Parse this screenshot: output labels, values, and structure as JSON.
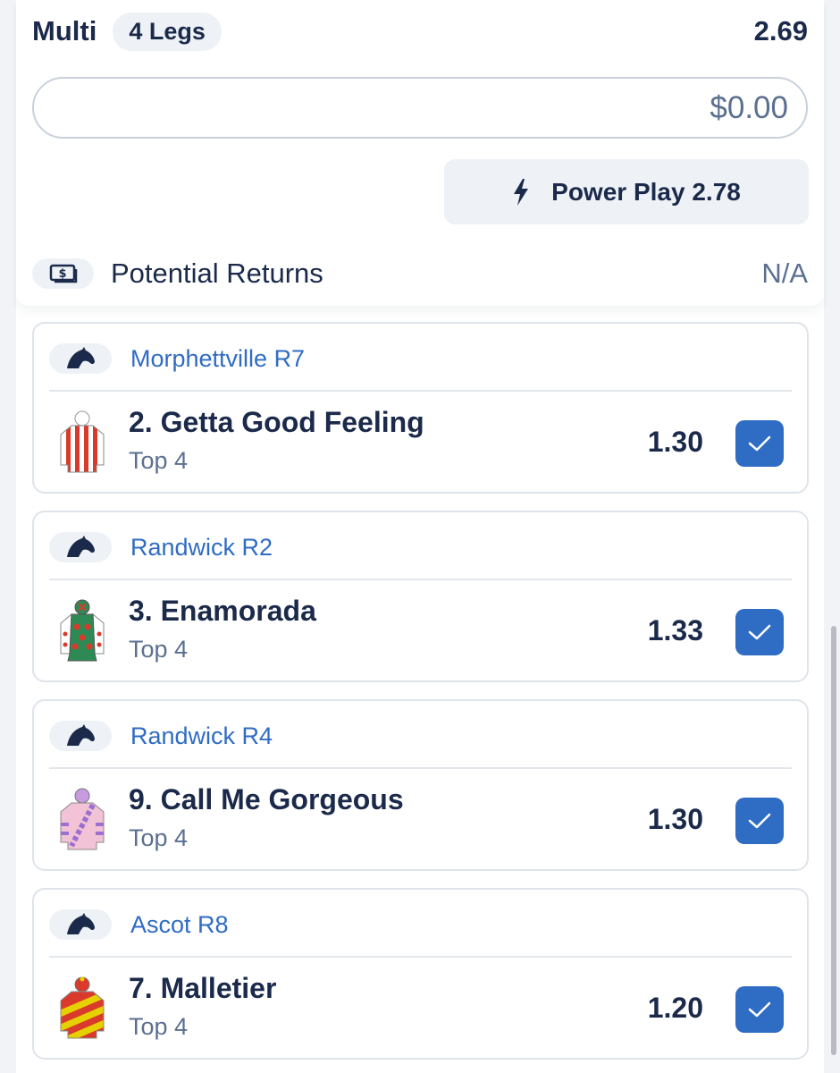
{
  "bet_slip": {
    "title": "Multi",
    "legs_count": "4 Legs",
    "total_odds": "2.69",
    "stake_value": "$0.00",
    "power_play_label": "Power Play 2.78",
    "potential_returns_label": "Potential Returns",
    "potential_returns_value": "N/A"
  },
  "legs": [
    {
      "race": "Morphettville R7",
      "runner": "2. Getta Good Feeling",
      "market": "Top 4",
      "odds": "1.30",
      "selected": true,
      "silk_icon": "jockey-silk-red-white-stripes-icon"
    },
    {
      "race": "Randwick R2",
      "runner": "3. Enamorada",
      "market": "Top 4",
      "odds": "1.33",
      "selected": true,
      "silk_icon": "jockey-silk-green-red-stars-icon"
    },
    {
      "race": "Randwick R4",
      "runner": "9. Call Me Gorgeous",
      "market": "Top 4",
      "odds": "1.30",
      "selected": true,
      "silk_icon": "jockey-silk-pink-purple-sash-icon"
    },
    {
      "race": "Ascot R8",
      "runner": "7. Malletier",
      "market": "Top 4",
      "odds": "1.20",
      "selected": true,
      "silk_icon": "jockey-silk-red-yellow-hoops-icon"
    }
  ],
  "colors": {
    "accent_blue": "#2f6cc4",
    "navy_text": "#1b2a4a",
    "muted_text": "#5b7090",
    "pill_bg": "#eef2f7"
  }
}
